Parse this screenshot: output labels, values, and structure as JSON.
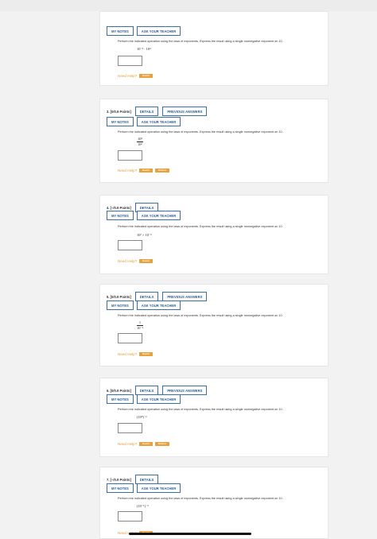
{
  "colors": {
    "button_border": "#3a6ea8",
    "help_label": "#e0a03a",
    "help_button": "#e8a13c"
  },
  "common": {
    "my_notes": "MY NOTES",
    "ask_teacher": "ASK YOUR TEACHER",
    "details": "DETAILS",
    "previous_answers": "PREVIOUS ANSWERS",
    "need_help": "Need Help?",
    "read_it": "Read It",
    "watch_it": "Watch It",
    "prompt": "Perform the indicated operation using the laws of exponents. Express the result using a single nonnegative exponent on 10."
  },
  "questions": [
    {
      "expr": "10⁻³ · 10⁴"
    },
    {
      "label": "3. [0/0.9 Points]",
      "num": "10⁹",
      "den": "10⁶"
    },
    {
      "label": "4. [–/0.9 Points]",
      "expr": "10⁷ × 10⁻²"
    },
    {
      "label": "5. [0/0.9 Points]",
      "num": "1",
      "den": "10⁻²"
    },
    {
      "label": "6. [0/0.9 Points]",
      "expr": "(10⁹)⁻²"
    },
    {
      "label": "7. [–/0.9 Points]",
      "expr": "(10⁻¹)⁻³"
    }
  ]
}
